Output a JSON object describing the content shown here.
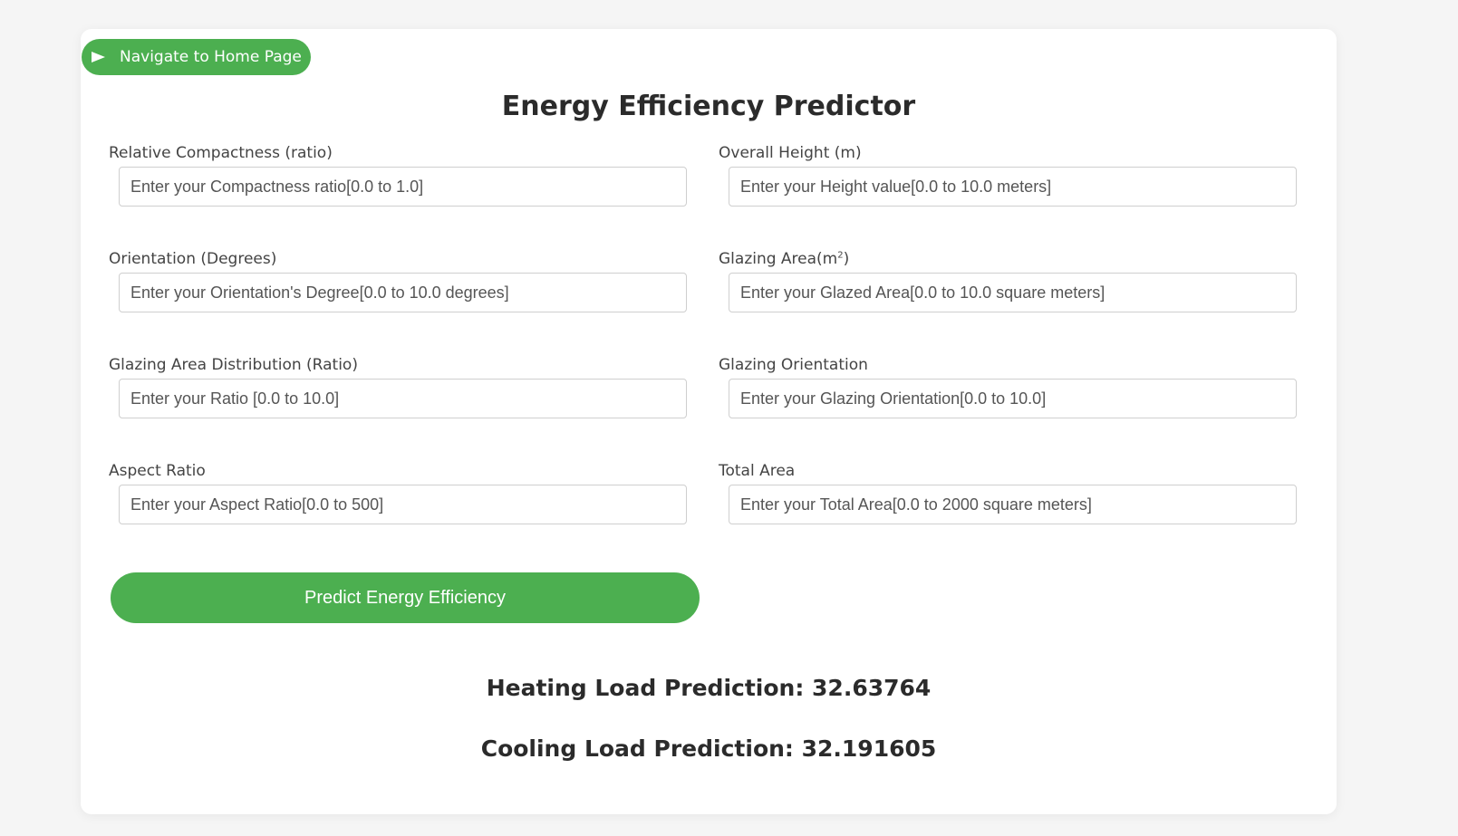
{
  "nav": {
    "home_label": "Navigate to Home Page"
  },
  "page": {
    "title": "Energy Efficiency Predictor"
  },
  "fields": {
    "relative_compactness": {
      "label": "Relative Compactness (ratio)",
      "placeholder": "Enter your Compactness ratio[0.0 to 1.0]",
      "value": ""
    },
    "overall_height": {
      "label": "Overall Height (m)",
      "placeholder": "Enter your Height value[0.0 to 10.0 meters]",
      "value": ""
    },
    "orientation": {
      "label": "Orientation (Degrees)",
      "placeholder": "Enter your Orientation's Degree[0.0 to 10.0 degrees]",
      "value": ""
    },
    "glazing_area": {
      "label": "Glazing Area(m",
      "label_sup": "2",
      "label_suffix": ")",
      "placeholder": "Enter your Glazed Area[0.0 to 10.0 square meters]",
      "value": ""
    },
    "glazing_area_distribution": {
      "label": "Glazing Area Distribution (Ratio)",
      "placeholder": "Enter your Ratio [0.0 to 10.0]",
      "value": ""
    },
    "glazing_orientation": {
      "label": "Glazing Orientation",
      "placeholder": "Enter your Glazing Orientation[0.0 to 10.0]",
      "value": ""
    },
    "aspect_ratio": {
      "label": "Aspect Ratio",
      "placeholder": "Enter your Aspect Ratio[0.0 to 500]",
      "value": ""
    },
    "total_area": {
      "label": "Total Area",
      "placeholder": "Enter your Total Area[0.0 to 2000 square meters]",
      "value": ""
    }
  },
  "actions": {
    "predict_label": "Predict Energy Efficiency"
  },
  "results": {
    "heating": "Heating Load Prediction: 32.63764",
    "cooling": "Cooling Load Prediction: 32.191605"
  },
  "colors": {
    "accent": "#4caf50",
    "background": "#f5f5f5",
    "card": "#ffffff"
  }
}
